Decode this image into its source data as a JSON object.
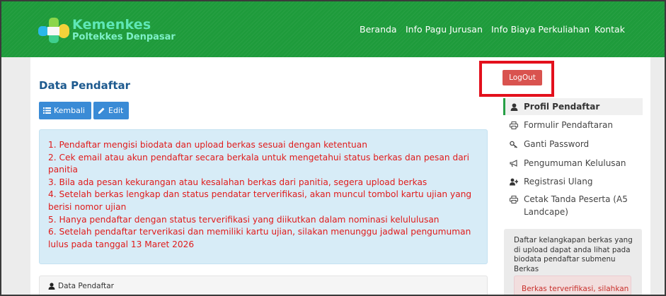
{
  "navbar": {
    "brand_title": "Kemenkes",
    "brand_subtitle": "Poltekkes Denpasar",
    "links": [
      "Beranda",
      "Info Pagu Jurusan",
      "Info Biaya Perkuliahan",
      "Kontak"
    ]
  },
  "main": {
    "title": "Data Pendaftar",
    "back_button": "Kembali",
    "edit_button": "Edit",
    "instructions": [
      "1. Pendaftar mengisi biodata dan upload berkas sesuai dengan ketentuan",
      "2. Cek email atau akun pendaftar secara berkala untuk mengetahui status berkas dan pesan dari panitia",
      "3. Bila ada pesan kekurangan atau kesalahan berkas dari panitia, segera upload berkas",
      "4. Setelah berkas lengkap dan status pendatar terverifikasi, akan muncul tombol kartu ujian yang berisi nomor ujian",
      "5. Hanya pendaftar dengan status terverifikasi yang diikutkan dalam nominasi kelululusan",
      "6. Setelah pendaftar terverikasi dan memiliki kartu ujian, silakan menunggu jadwal pengumuman lulus pada tanggal 13 Maret 2026"
    ],
    "panel_heading": "Data Pendaftar"
  },
  "sidebar": {
    "logout": "LogOut",
    "items": [
      {
        "label": "Profil Pendaftar",
        "icon": "user-icon"
      },
      {
        "label": "Formulir Pendaftaran",
        "icon": "print-icon"
      },
      {
        "label": "Ganti Password",
        "icon": "key-icon"
      },
      {
        "label": "Pengumuman Kelulusan",
        "icon": "bullhorn-icon"
      },
      {
        "label": "Registrasi Ulang",
        "icon": "user-plus-icon"
      },
      {
        "label": "Cetak Tanda Peserta (A5 Landcape)",
        "icon": "print-icon"
      }
    ],
    "info_text": "Daftar kelangkapan berkas yang di upload dapat anda lihat pada biodata pendaftar submenu Berkas",
    "alert_text": "Berkas terverifikasi, silahkan"
  },
  "colors": {
    "navbar": "#1e9b3b",
    "logout": "#d9534f",
    "highlight_border": "#e3101c",
    "button": "#3a8bd6",
    "instruction_text": "#e01b1b"
  }
}
